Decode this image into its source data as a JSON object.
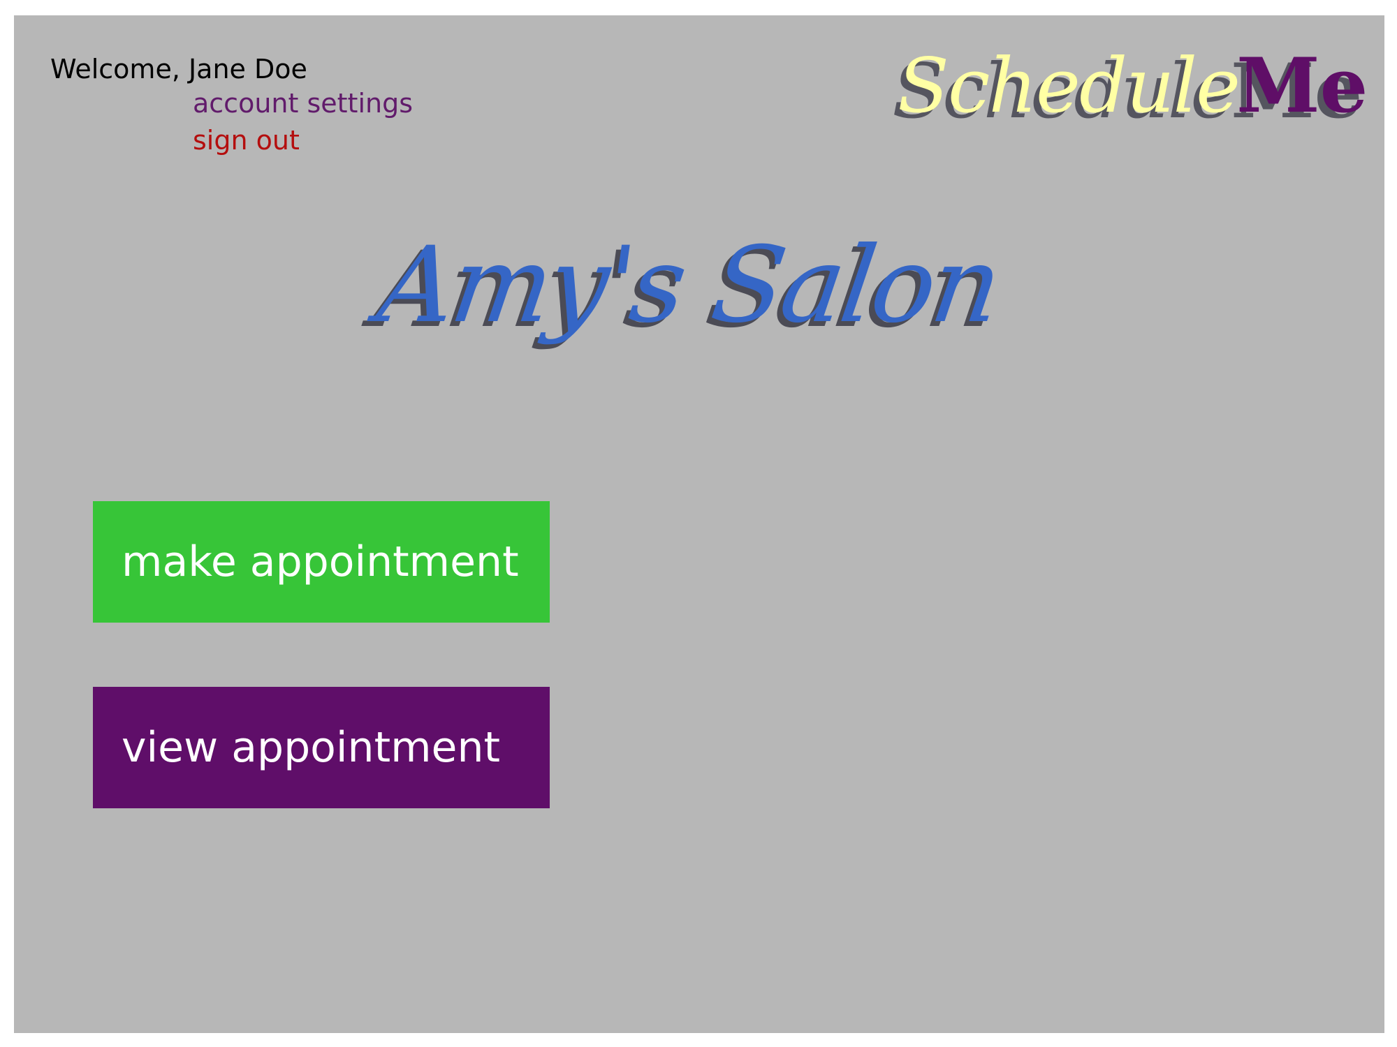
{
  "header": {
    "welcome_text": "Welcome, Jane Doe",
    "account_settings_label": "account settings",
    "sign_out_label": "sign out"
  },
  "brand": {
    "part1": "Schedule",
    "part2": "Me"
  },
  "main": {
    "business_name": "Amy's Salon",
    "buttons": {
      "make_label": "make appointment",
      "view_label": "view appointment"
    }
  },
  "colors": {
    "background": "#b7b7b7",
    "brand_yellow": "#ffffa4",
    "brand_purple": "#5f0e67",
    "title_blue": "#3566c6",
    "make_button": "#37c538",
    "view_button": "#5f0e69",
    "account_link": "#611b6b",
    "sign_out_link": "#b40e0e"
  }
}
